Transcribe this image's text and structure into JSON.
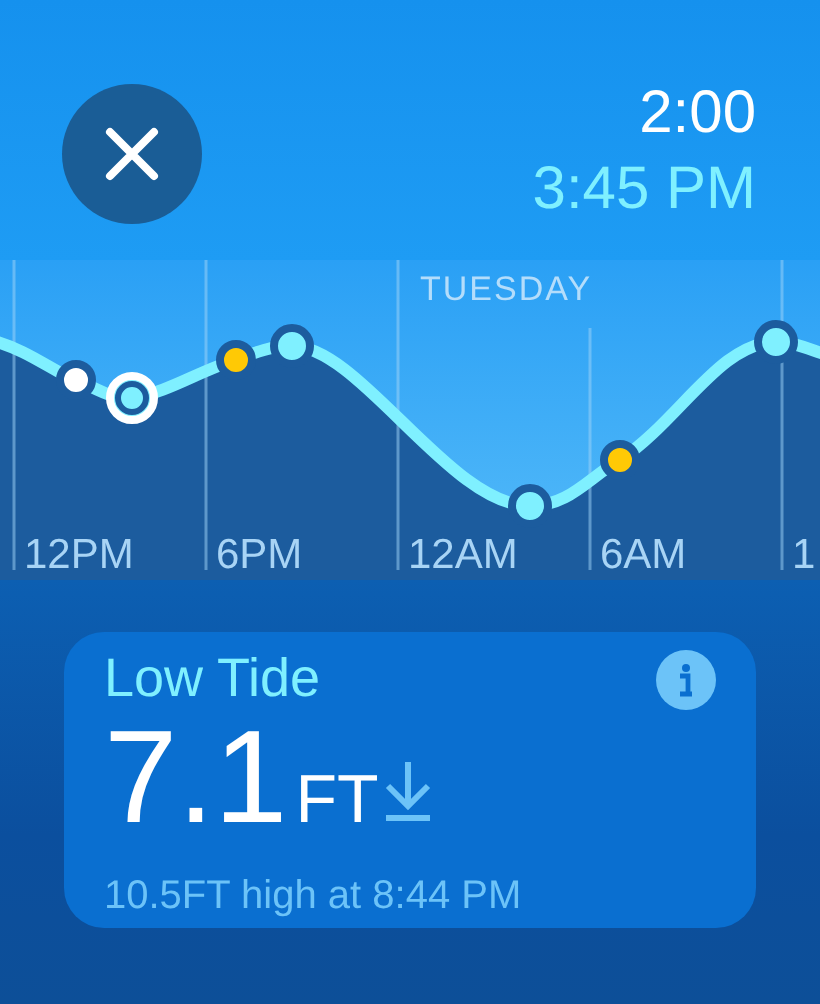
{
  "header": {
    "clock": "2:00",
    "selected_time": "3:45 PM"
  },
  "chart": {
    "day_label": "TUESDAY",
    "hour_labels": [
      "12PM",
      "6PM",
      "12AM",
      "6AM",
      "1"
    ]
  },
  "card": {
    "title": "Low Tide",
    "value": "7.1",
    "unit": "FT",
    "falling": true,
    "subtitle": "10.5FT high at 8:44 PM"
  }
}
